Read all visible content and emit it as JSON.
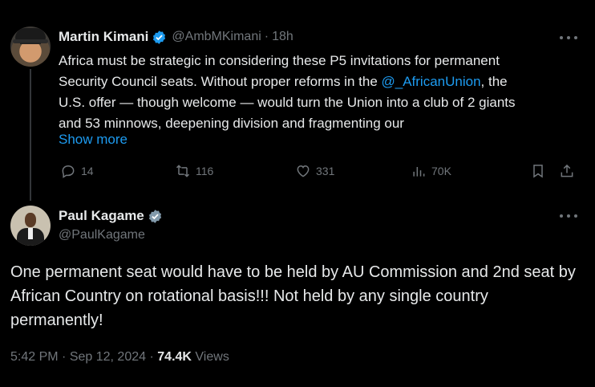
{
  "parent_tweet": {
    "author_name": "Martin Kimani",
    "handle": "@AmbMKimani",
    "separator": "·",
    "time": "18h",
    "text_line1": "Africa must be strategic in considering these P5 invitations for permanent",
    "text_line2_pre": "Security Council seats. Without proper reforms in the ",
    "mention": "@_AfricanUnion",
    "text_line2_post": ", the",
    "text_line3": "U.S. offer — though welcome — would turn the Union into a club of 2 giants",
    "text_line4": "and 53 minnows, deepening division and fragmenting our",
    "show_more": "Show more",
    "replies": "14",
    "reposts": "116",
    "likes": "331",
    "views": "70K",
    "verified_color": "#1d9bf0"
  },
  "main_tweet": {
    "author_name": "Paul Kagame",
    "handle": "@PaulKagame",
    "verified_color": "#829aab",
    "text": "One permanent seat would have to be held by AU Commission and 2nd seat by African Country on rotational basis!!! Not held by any single country permanently!",
    "time": "5:42 PM",
    "sep1": "·",
    "date": "Sep 12, 2024",
    "sep2": "·",
    "views_count": "74.4K",
    "views_label": "Views"
  },
  "colors": {
    "background": "#000000",
    "text": "#e7e9ea",
    "muted": "#71767b",
    "link": "#1d9bf0"
  }
}
